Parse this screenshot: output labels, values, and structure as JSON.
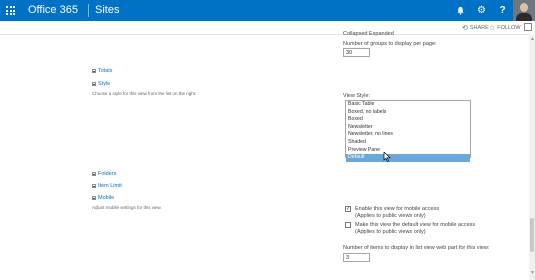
{
  "suite": {
    "brand": "Office 365",
    "site": "Sites"
  },
  "actions": {
    "share": "SHARE",
    "follow": "FOLLOW"
  },
  "group_by": {
    "partial_text": "Collapsed   Expanded",
    "groups_label": "Number of groups to display per page:",
    "groups_value": "30"
  },
  "sections": {
    "totals": "Totals",
    "style": "Style",
    "style_desc": "Choose a style for this view from the list on the right.",
    "folders": "Folders",
    "item_limit": "Item Limit",
    "mobile": "Mobile",
    "mobile_desc": "Adjust mobile settings for this view."
  },
  "view_style": {
    "label": "View Style:",
    "options": [
      "Basic Table",
      "Boxed, no labels",
      "Boxed",
      "Newsletter",
      "Newsletter, no lines",
      "Shaded",
      "Preview Pane",
      "Default"
    ],
    "selected": "Default"
  },
  "mobile_settings": {
    "enable_label": "Enable this view for mobile access",
    "enable_note": "(Applies to public views only)",
    "enable_checked": true,
    "default_label": "Make this view the default view for mobile access",
    "default_note": "(Applies to public views only)",
    "default_checked": false,
    "items_label": "Number of items to display in list view web part for this view:",
    "items_value": "3"
  },
  "colors": {
    "suite_bar": "#0072c6",
    "selected_option": "#6ca7d9",
    "link": "#0072c6"
  },
  "icons": [
    "waffle-icon",
    "bell-icon",
    "gear-icon",
    "help-icon",
    "share-icon",
    "follow-star-icon",
    "fullscreen-icon",
    "cursor-icon"
  ]
}
